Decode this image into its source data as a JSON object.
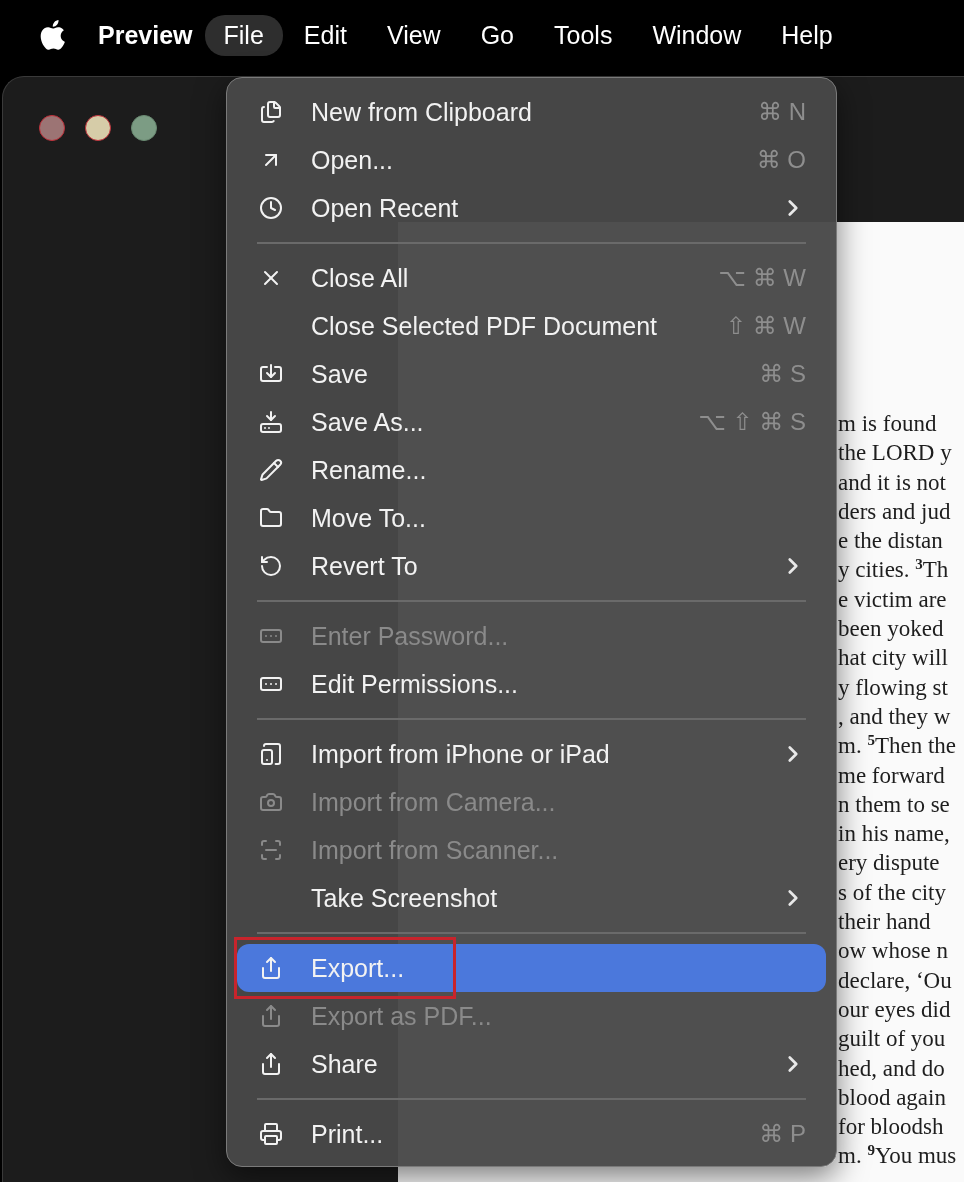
{
  "menubar": {
    "app_name": "Preview",
    "items": [
      {
        "label": "File",
        "selected": true
      },
      {
        "label": "Edit",
        "selected": false
      },
      {
        "label": "View",
        "selected": false
      },
      {
        "label": "Go",
        "selected": false
      },
      {
        "label": "Tools",
        "selected": false
      },
      {
        "label": "Window",
        "selected": false
      },
      {
        "label": "Help",
        "selected": false
      }
    ]
  },
  "file_menu": [
    {
      "kind": "item",
      "label": "New from Clipboard",
      "shortcut": "⌘ N",
      "submenu": false,
      "disabled": false,
      "selected": false
    },
    {
      "kind": "item",
      "label": "Open...",
      "shortcut": "⌘ O",
      "submenu": false,
      "disabled": false,
      "selected": false
    },
    {
      "kind": "item",
      "label": "Open Recent",
      "submenu": true,
      "disabled": false,
      "selected": false
    },
    {
      "kind": "separator"
    },
    {
      "kind": "item",
      "label": "Close All",
      "shortcut": "⌥ ⌘ W",
      "submenu": false,
      "disabled": false,
      "selected": false
    },
    {
      "kind": "item",
      "label": "Close Selected PDF Document",
      "shortcut": "⇧ ⌘ W",
      "submenu": false,
      "disabled": false,
      "selected": false
    },
    {
      "kind": "item",
      "label": "Save",
      "shortcut": "⌘ S",
      "submenu": false,
      "disabled": false,
      "selected": false
    },
    {
      "kind": "item",
      "label": "Save As...",
      "shortcut": "⌥ ⇧ ⌘ S",
      "submenu": false,
      "disabled": false,
      "selected": false
    },
    {
      "kind": "item",
      "label": "Rename...",
      "submenu": false,
      "disabled": false,
      "selected": false
    },
    {
      "kind": "item",
      "label": "Move To...",
      "submenu": false,
      "disabled": false,
      "selected": false
    },
    {
      "kind": "item",
      "label": "Revert To",
      "submenu": true,
      "disabled": false,
      "selected": false
    },
    {
      "kind": "separator"
    },
    {
      "kind": "item",
      "label": "Enter Password...",
      "submenu": false,
      "disabled": true,
      "selected": false
    },
    {
      "kind": "item",
      "label": "Edit Permissions...",
      "submenu": false,
      "disabled": false,
      "selected": false
    },
    {
      "kind": "separator"
    },
    {
      "kind": "item",
      "label": "Import from iPhone or iPad",
      "submenu": true,
      "disabled": false,
      "selected": false
    },
    {
      "kind": "item",
      "label": "Import from Camera...",
      "submenu": false,
      "disabled": true,
      "selected": false
    },
    {
      "kind": "item",
      "label": "Import from Scanner...",
      "submenu": false,
      "disabled": true,
      "selected": false
    },
    {
      "kind": "item",
      "label": "Take Screenshot",
      "submenu": true,
      "disabled": false,
      "selected": false
    },
    {
      "kind": "separator"
    },
    {
      "kind": "item",
      "label": "Export...",
      "submenu": false,
      "disabled": false,
      "selected": true,
      "highlighted_frame": true
    },
    {
      "kind": "item",
      "label": "Export as PDF...",
      "submenu": false,
      "disabled": true,
      "selected": false
    },
    {
      "kind": "item",
      "label": "Share",
      "submenu": true,
      "disabled": false,
      "selected": false
    },
    {
      "kind": "separator"
    },
    {
      "kind": "item",
      "label": "Print...",
      "shortcut": "⌘ P",
      "submenu": false,
      "disabled": false,
      "selected": false
    }
  ],
  "document_lines": [
    "m is found",
    "the LORD y",
    "and it is not",
    "ders and jud",
    "e the distan",
    "y cities. $^{3}$Th",
    "e victim are",
    "been yoked",
    "hat city will",
    "y flowing st",
    ", and they w",
    "m. $^{5}$Then the",
    "me forward",
    "n them to se",
    "in his name,",
    "ery dispute",
    "s of the city",
    "their hand",
    "ow whose n",
    "declare, ‘Ou",
    "our eyes did",
    "guilt of you",
    "hed, and do",
    "blood again",
    "for bloodsh",
    "m. $^{9}$You mus"
  ]
}
